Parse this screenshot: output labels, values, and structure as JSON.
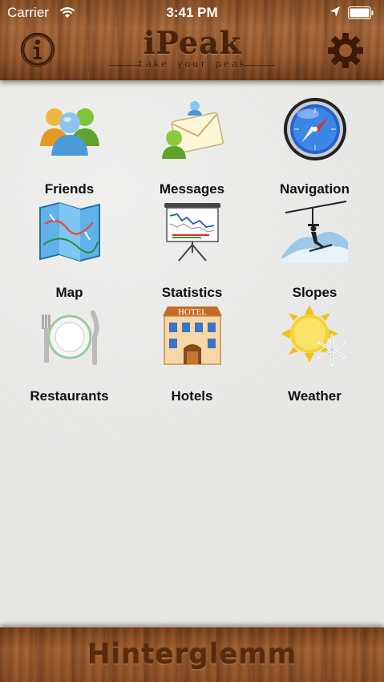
{
  "status_bar": {
    "carrier": "Carrier",
    "time": "3:41 PM",
    "wifi_icon": "wifi-icon",
    "location_icon": "location-arrow-icon",
    "battery_icon": "battery-full-icon"
  },
  "header": {
    "title": "iPeak",
    "tagline": "take your peak",
    "info_icon": "info-icon",
    "settings_icon": "gear-icon"
  },
  "menu": [
    {
      "label": "Friends",
      "icon": "friends-icon"
    },
    {
      "label": "Messages",
      "icon": "messages-icon"
    },
    {
      "label": "Navigation",
      "icon": "compass-icon"
    },
    {
      "label": "Map",
      "icon": "map-icon"
    },
    {
      "label": "Statistics",
      "icon": "statistics-icon"
    },
    {
      "label": "Slopes",
      "icon": "ski-lift-icon"
    },
    {
      "label": "Restaurants",
      "icon": "plate-cutlery-icon"
    },
    {
      "label": "Hotels",
      "icon": "hotel-icon"
    },
    {
      "label": "Weather",
      "icon": "sun-snowflake-icon"
    }
  ],
  "hotel_sign": "HOTEL",
  "footer": {
    "location": "Hinterglemm"
  },
  "colors": {
    "wood_dark": "#6e3a17",
    "wood_light": "#a8683a",
    "engraved_text": "#4a2208",
    "background": "#e8e8e6"
  }
}
